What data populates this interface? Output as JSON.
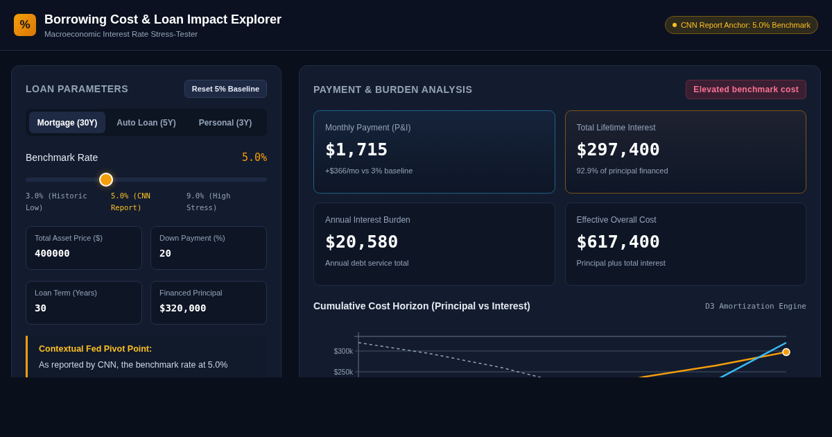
{
  "header": {
    "logo": "%",
    "title": "Borrowing Cost & Loan Impact Explorer",
    "subtitle": "Macroeconomic Interest Rate Stress-Tester",
    "badge": "CNN Report Anchor: 5.0% Benchmark"
  },
  "loan_panel": {
    "title": "LOAN PARAMETERS",
    "reset_button": "Reset 5% Baseline",
    "tabs": [
      {
        "label": "Mortgage (30Y)",
        "selected": true
      },
      {
        "label": "Auto Loan (5Y)",
        "selected": false
      },
      {
        "label": "Personal (3Y)",
        "selected": false
      }
    ],
    "rate": {
      "label": "Benchmark Rate",
      "value": "5.0%",
      "level": 0.333,
      "marks": [
        {
          "label": "3.0% (Historic Low)",
          "selected": false
        },
        {
          "label": "5.0% (CNN Report)",
          "selected": true
        },
        {
          "label": "9.0% (High Stress)",
          "selected": false
        }
      ]
    },
    "fields": [
      {
        "label": "Total Asset Price ($)",
        "value": "400000"
      },
      {
        "label": "Down Payment (%)",
        "value": "20"
      },
      {
        "label": "Loan Term (Years)",
        "value": "30"
      },
      {
        "label": "Financed Principal",
        "value": "$320,000"
      }
    ],
    "note": {
      "title": "Contextual Fed Pivot Point:",
      "text": "As reported by CNN, the benchmark rate at 5.0%"
    }
  },
  "analysis": {
    "title": "PAYMENT & BURDEN ANALYSIS",
    "status_badge": "Elevated benchmark cost",
    "metrics": [
      {
        "label": "Monthly Payment (P&I)",
        "value": "$1,715",
        "note": "+$366/mo vs 3% baseline",
        "kind": "primary"
      },
      {
        "label": "Total Lifetime Interest",
        "value": "$297,400",
        "note": "92.9% of principal financed",
        "kind": "warning"
      },
      {
        "label": "Annual Interest Burden",
        "value": "$20,580",
        "note": "Annual debt service total",
        "kind": "plain"
      },
      {
        "label": "Effective Overall Cost",
        "value": "$617,400",
        "note": "Principal plus total interest",
        "kind": "plain"
      }
    ],
    "chart": {
      "title": "Cumulative Cost Horizon (Principal vs Interest)",
      "engine": "D3 Amortization Engine",
      "y_labels": [
        "$300k",
        "$250k"
      ]
    }
  }
}
